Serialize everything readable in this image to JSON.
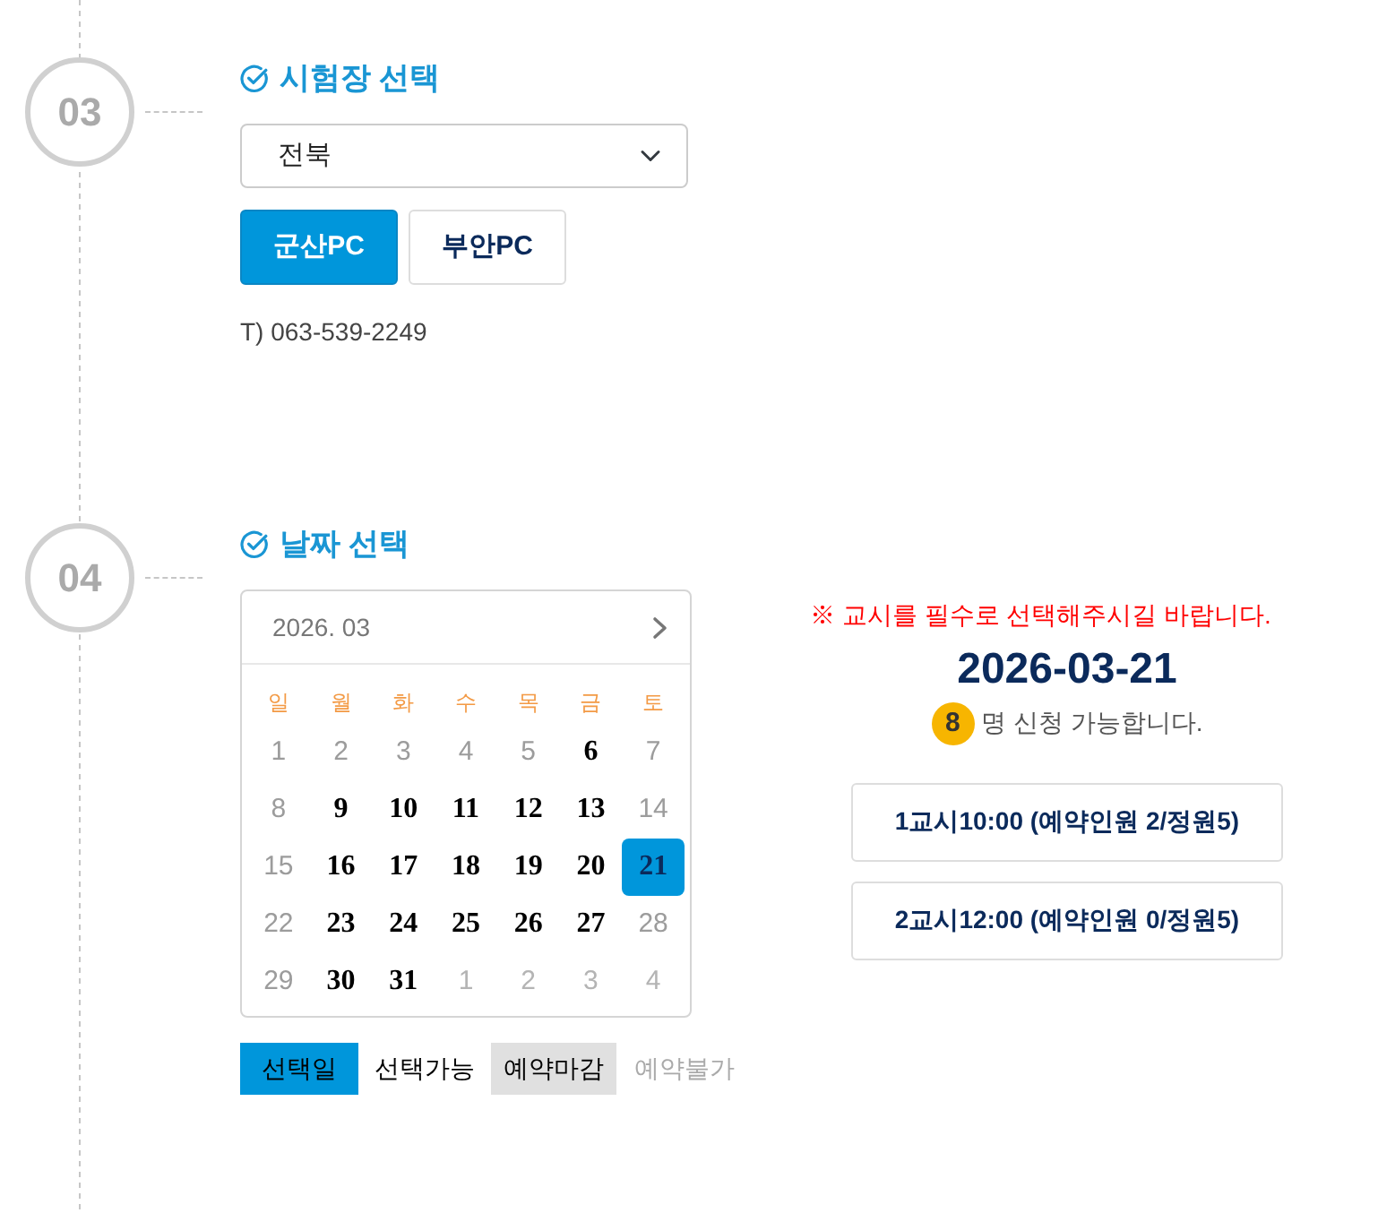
{
  "sections": [
    {
      "kind": "site",
      "number": "03",
      "title": "시험장 선택",
      "region_select": {
        "value": "전북"
      },
      "sites": [
        {
          "label": "군산PC",
          "selected": true
        },
        {
          "label": "부안PC",
          "selected": false
        }
      ],
      "phone": "T) 063-539-2249"
    },
    {
      "kind": "date",
      "number": "04",
      "title": "날짜 선택",
      "calendar": {
        "month_label": "2026. 03",
        "weekdays": [
          "일",
          "월",
          "화",
          "수",
          "목",
          "금",
          "토"
        ],
        "days": [
          {
            "label": "1",
            "kind": "unavailable",
            "selected": false
          },
          {
            "label": "2",
            "kind": "unavailable",
            "selected": false
          },
          {
            "label": "3",
            "kind": "unavailable",
            "selected": false
          },
          {
            "label": "4",
            "kind": "unavailable",
            "selected": false
          },
          {
            "label": "5",
            "kind": "unavailable",
            "selected": false
          },
          {
            "label": "6",
            "kind": "available",
            "selected": false
          },
          {
            "label": "7",
            "kind": "unavailable",
            "selected": false
          },
          {
            "label": "8",
            "kind": "unavailable",
            "selected": false
          },
          {
            "label": "9",
            "kind": "available",
            "selected": false
          },
          {
            "label": "10",
            "kind": "available",
            "selected": false
          },
          {
            "label": "11",
            "kind": "available",
            "selected": false
          },
          {
            "label": "12",
            "kind": "available",
            "selected": false
          },
          {
            "label": "13",
            "kind": "available",
            "selected": false
          },
          {
            "label": "14",
            "kind": "unavailable",
            "selected": false
          },
          {
            "label": "15",
            "kind": "unavailable",
            "selected": false
          },
          {
            "label": "16",
            "kind": "available",
            "selected": false
          },
          {
            "label": "17",
            "kind": "available",
            "selected": false
          },
          {
            "label": "18",
            "kind": "available",
            "selected": false
          },
          {
            "label": "19",
            "kind": "available",
            "selected": false
          },
          {
            "label": "20",
            "kind": "available",
            "selected": false
          },
          {
            "label": "21",
            "kind": "available",
            "selected": true
          },
          {
            "label": "22",
            "kind": "unavailable",
            "selected": false
          },
          {
            "label": "23",
            "kind": "available",
            "selected": false
          },
          {
            "label": "24",
            "kind": "available",
            "selected": false
          },
          {
            "label": "25",
            "kind": "available",
            "selected": false
          },
          {
            "label": "26",
            "kind": "available",
            "selected": false
          },
          {
            "label": "27",
            "kind": "available",
            "selected": false
          },
          {
            "label": "28",
            "kind": "unavailable",
            "selected": false
          },
          {
            "label": "29",
            "kind": "unavailable",
            "selected": false
          },
          {
            "label": "30",
            "kind": "available",
            "selected": false
          },
          {
            "label": "31",
            "kind": "available",
            "selected": false
          },
          {
            "label": "1",
            "kind": "other-month",
            "selected": false
          },
          {
            "label": "2",
            "kind": "other-month",
            "selected": false
          },
          {
            "label": "3",
            "kind": "other-month",
            "selected": false
          },
          {
            "label": "4",
            "kind": "other-month",
            "selected": false
          }
        ]
      },
      "legend": [
        {
          "label": "선택일",
          "kind": "selected"
        },
        {
          "label": "선택가능",
          "kind": "available"
        },
        {
          "label": "예약마감",
          "kind": "closed"
        },
        {
          "label": "예약불가",
          "kind": "unavailable"
        }
      ],
      "notice": "※ 교시를 필수로 선택해주시길 바랍니다.",
      "selected_date": "2026-03-21",
      "available_count": "8",
      "available_text": "명 신청 가능합니다.",
      "time_slots": [
        "1교시10:00 (예약인원 2/정원5)",
        "2교시12:00 (예약인원 0/정원5)"
      ]
    }
  ]
}
